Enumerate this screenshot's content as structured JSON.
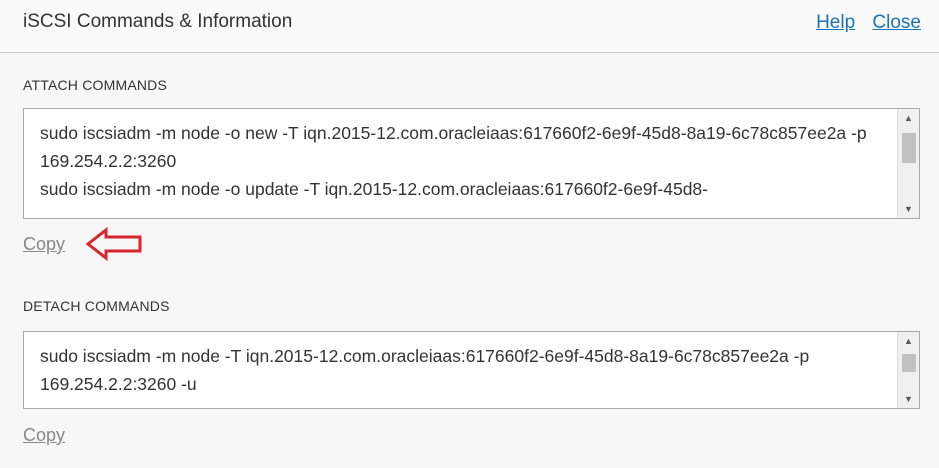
{
  "header": {
    "title": "iSCSI Commands & Information",
    "help_label": "Help",
    "close_label": "Close"
  },
  "attach": {
    "label": "ATTACH COMMANDS",
    "text": "sudo iscsiadm -m node -o new -T iqn.2015-12.com.oracleiaas:617660f2-6e9f-45d8-8a19-6c78c857ee2a -p 169.254.2.2:3260\nsudo iscsiadm -m node -o update -T iqn.2015-12.com.oracleiaas:617660f2-6e9f-45d8-",
    "copy_label": "Copy"
  },
  "detach": {
    "label": "DETACH COMMANDS",
    "text": "sudo iscsiadm -m node -T iqn.2015-12.com.oracleiaas:617660f2-6e9f-45d8-8a19-6c78c857ee2a -p 169.254.2.2:3260 -u",
    "copy_label": "Copy"
  },
  "annotation": {
    "arrow_color": "#d9262c"
  }
}
